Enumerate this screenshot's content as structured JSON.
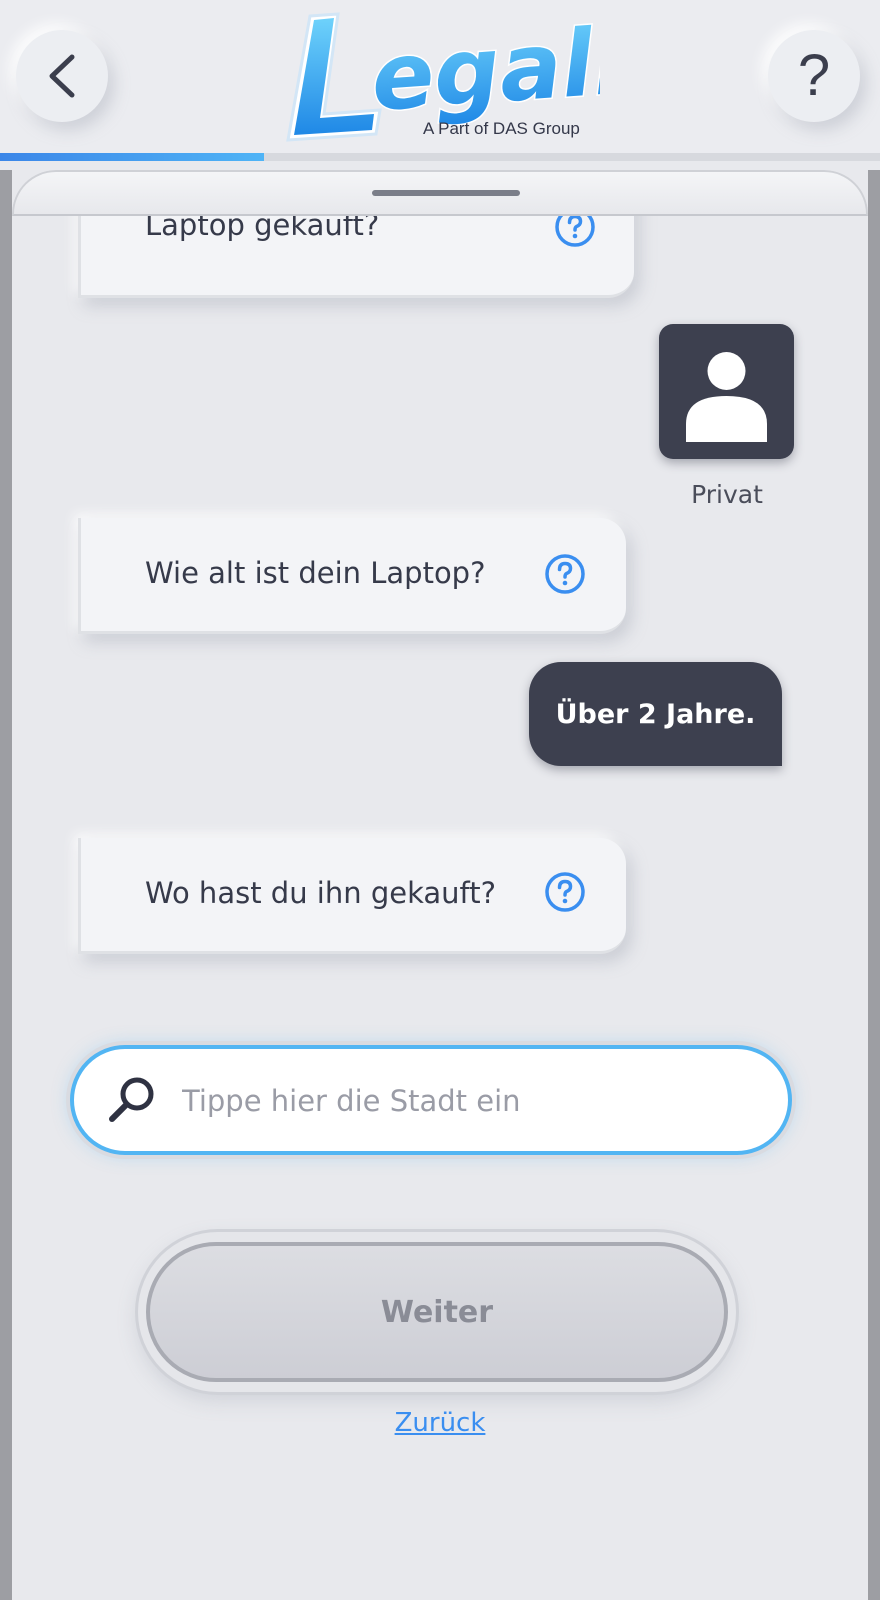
{
  "header": {
    "logo_text": "Legally",
    "logo_tagline": "A Part of DAS Group",
    "progress_fraction": 0.3,
    "accent_color": "#3b86e8"
  },
  "chat": {
    "bot_questions": [
      "Laptop gekauft?",
      "Wie alt ist dein Laptop?",
      "Wo hast du ihn gekauft?"
    ],
    "selected_card_label": "Privat",
    "user_reply": "Über 2 Jahre."
  },
  "search": {
    "placeholder": "Tippe hier die Stadt ein",
    "value": ""
  },
  "actions": {
    "next_label": "Weiter",
    "back_label": "Zurück"
  }
}
